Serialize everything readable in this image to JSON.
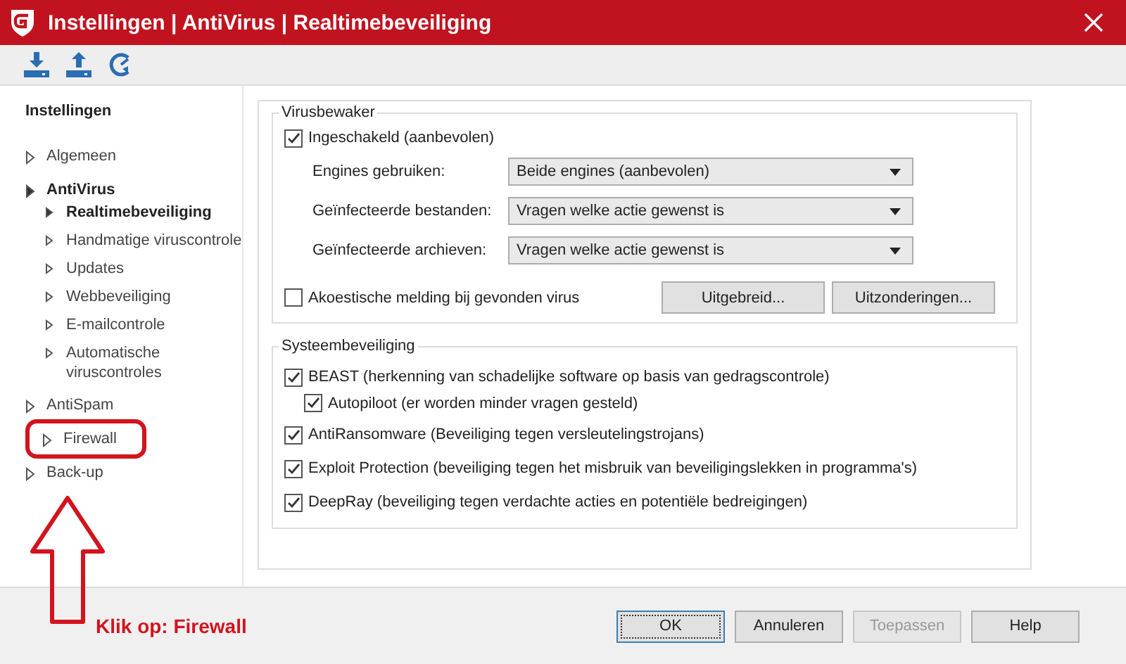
{
  "window": {
    "title": "Instellingen | AntiVirus | Realtimebeveiliging"
  },
  "sidebar": {
    "heading": "Instellingen",
    "items": [
      {
        "label": "Algemeen",
        "selected": false,
        "highlighted": false
      },
      {
        "label": "AntiVirus",
        "selected": true,
        "highlighted": false,
        "children": [
          {
            "label": "Realtimebeveiliging",
            "selected": true
          },
          {
            "label": "Handmatige viruscontrole",
            "selected": false
          },
          {
            "label": "Updates",
            "selected": false
          },
          {
            "label": "Webbeveiliging",
            "selected": false
          },
          {
            "label": "E-mailcontrole",
            "selected": false
          },
          {
            "label": "Automatische viruscontroles",
            "selected": false
          }
        ]
      },
      {
        "label": "AntiSpam",
        "selected": false,
        "highlighted": false
      },
      {
        "label": "Firewall",
        "selected": false,
        "highlighted": true
      },
      {
        "label": "Back-up",
        "selected": false,
        "highlighted": false
      }
    ]
  },
  "virusbewaker": {
    "title": "Virusbewaker",
    "enabled": {
      "label": "Ingeschakeld (aanbevolen)",
      "checked": true
    },
    "selects": [
      {
        "label": "Engines gebruiken:",
        "value": "Beide engines (aanbevolen)"
      },
      {
        "label": "Geïnfecteerde bestanden:",
        "value": "Vragen welke actie gewenst is"
      },
      {
        "label": "Geïnfecteerde archieven:",
        "value": "Vragen welke actie gewenst is"
      }
    ],
    "acoustic": {
      "label": "Akoestische melding bij gevonden virus",
      "checked": false
    },
    "buttons": [
      "Uitgebreid...",
      "Uitzonderingen..."
    ]
  },
  "systeembeveiliging": {
    "title": "Systeembeveiliging",
    "options": [
      {
        "label": "BEAST (herkenning van schadelijke software op basis van gedragscontrole)",
        "checked": true,
        "children": [
          {
            "label": "Autopiloot (er worden minder vragen gesteld)",
            "checked": true
          }
        ]
      },
      {
        "label": "AntiRansomware (Beveiliging tegen versleutelingstrojans)",
        "checked": true
      },
      {
        "label": "Exploit Protection (beveiliging tegen het misbruik van beveiligingslekken in programma's)",
        "checked": true
      },
      {
        "label": "DeepRay (beveiliging tegen verdachte acties en potentiële bedreigingen)",
        "checked": true
      }
    ]
  },
  "annotation": {
    "text": "Klik op: Firewall"
  },
  "buttons": [
    {
      "label": "OK",
      "default": true,
      "disabled": false
    },
    {
      "label": "Annuleren",
      "default": false,
      "disabled": false
    },
    {
      "label": "Toepassen",
      "default": false,
      "disabled": true
    },
    {
      "label": "Help",
      "default": false,
      "disabled": false
    }
  ]
}
